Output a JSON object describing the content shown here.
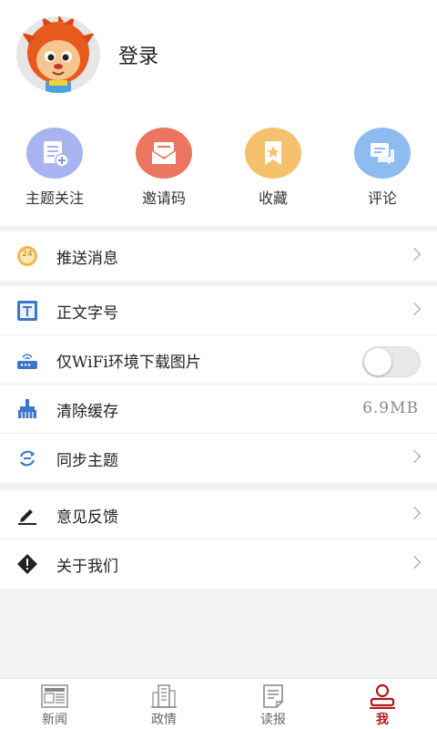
{
  "profile": {
    "login_label": "登录"
  },
  "shortcuts": [
    {
      "label": "主题关注",
      "icon": "subject-follow-icon",
      "color": "#a9b3ef"
    },
    {
      "label": "邀请码",
      "icon": "invite-code-icon",
      "color": "#ec7560"
    },
    {
      "label": "收藏",
      "icon": "favorite-icon",
      "color": "#f5c16c"
    },
    {
      "label": "评论",
      "icon": "comment-icon",
      "color": "#8fbcf0"
    }
  ],
  "menu": {
    "push": {
      "label": "推送消息",
      "badge": "24"
    },
    "font_size": {
      "label": "正文字号"
    },
    "wifi_images": {
      "label": "仅WiFi环境下载图片",
      "enabled": false
    },
    "clear_cache": {
      "label": "清除缓存",
      "value": "6.9MB"
    },
    "sync_topics": {
      "label": "同步主题"
    },
    "feedback": {
      "label": "意见反馈"
    },
    "about": {
      "label": "关于我们"
    }
  },
  "tabbar": {
    "accent": "#b0181c",
    "tabs": [
      {
        "label": "新闻",
        "icon": "newspaper-icon",
        "active": false
      },
      {
        "label": "政情",
        "icon": "building-icon",
        "active": false
      },
      {
        "label": "读报",
        "icon": "document-icon",
        "active": false
      },
      {
        "label": "我",
        "icon": "user-icon",
        "active": true
      }
    ]
  }
}
